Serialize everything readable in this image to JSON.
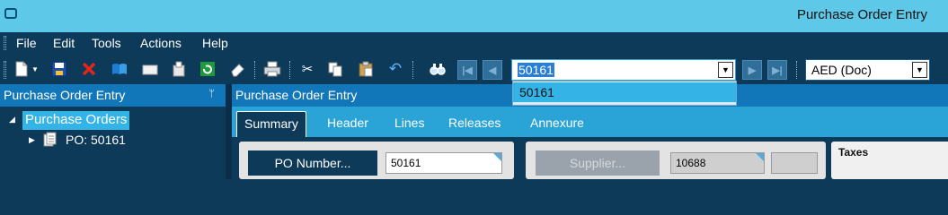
{
  "window": {
    "title": "Purchase Order Entry"
  },
  "menu": {
    "items": [
      "File",
      "Edit",
      "Tools",
      "Actions",
      "Help"
    ]
  },
  "toolbar": {
    "icons": [
      "new-document-icon",
      "save-icon",
      "delete-icon",
      "book-icon",
      "folder-icon",
      "attach-icon",
      "refresh-icon",
      "eraser-icon",
      "print-icon",
      "cut-icon",
      "copy-icon",
      "paste-icon",
      "undo-icon",
      "find-icon"
    ],
    "nav_first": "|◀",
    "nav_prev": "◀",
    "nav_next": "▶",
    "nav_last": "▶|",
    "record_combo_value": "50161",
    "currency_combo_value": "AED (Doc)"
  },
  "record_dropdown": {
    "options": [
      "50161"
    ]
  },
  "left_panel": {
    "title": "Purchase Order Entry",
    "pin": "ᛘ",
    "tree": {
      "root_label": "Purchase Orders",
      "child_label": "PO: 50161"
    }
  },
  "right_panel": {
    "title": "Purchase Order Entry",
    "tabs": [
      "Summary",
      "Header",
      "Lines",
      "Releases",
      "Annexure"
    ],
    "active_tab": "Summary"
  },
  "summary": {
    "po_number_label": "PO Number...",
    "po_number_value": "50161",
    "supplier_label": "Supplier...",
    "supplier_value": "10688",
    "taxes_label": "Taxes"
  },
  "colors": {
    "title_bar": "#5ec8e8",
    "app_bg": "#0e3a5a",
    "panel_header": "#1277b8",
    "tab_strip": "#2aa3d6",
    "selection": "#33b3e6"
  }
}
